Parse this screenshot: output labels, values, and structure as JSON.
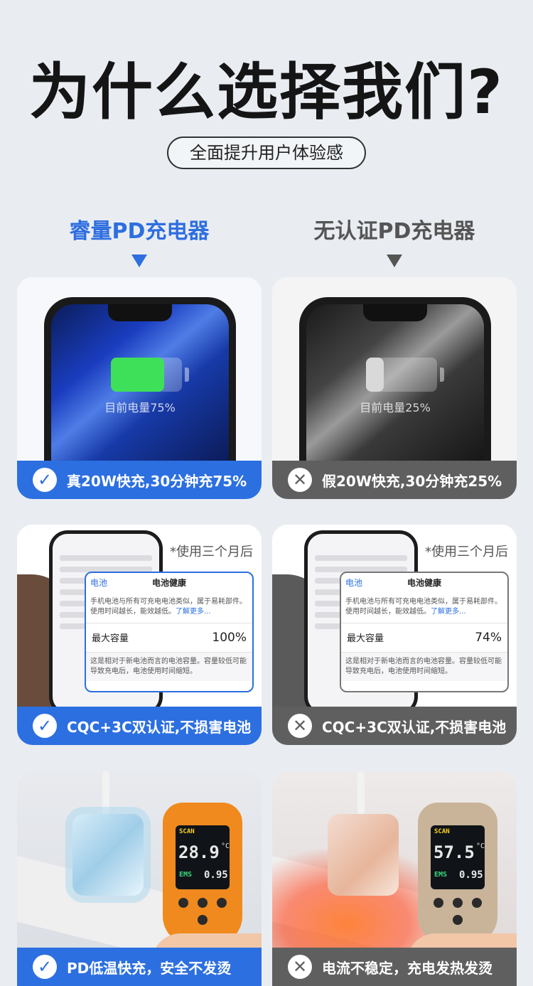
{
  "header": {
    "title": "为什么选择我们?",
    "subtitle": "全面提升用户体验感"
  },
  "columns": {
    "left": {
      "title": "睿量PD充电器",
      "color": "#2f6ee0"
    },
    "right": {
      "title": "无认证PD充电器",
      "color": "#555555"
    }
  },
  "row1": {
    "left": {
      "battery_text": "目前电量75%",
      "battery_level": 0.75,
      "caption": "真20W快充,30分钟充75%",
      "badge": "✓"
    },
    "right": {
      "battery_text": "目前电量25%",
      "battery_level": 0.25,
      "caption": "假20W快充,30分钟充25%",
      "badge": "✕"
    }
  },
  "row2": {
    "left": {
      "after_text": "*使用三个月后",
      "back": "电池",
      "panel_title": "电池健康",
      "desc": "手机电池与所有可充电电池类似，属于易耗部件。使用时间越长，能效越低。",
      "link": "了解更多...",
      "cap_label": "最大容量",
      "cap_value": "100%",
      "note": "这是相对于新电池而言的电池容量。容量较低可能导致充电后，电池使用时间缩短。",
      "caption": "CQC+3C双认证,不损害电池",
      "badge": "✓"
    },
    "right": {
      "after_text": "*使用三个月后",
      "back": "电池",
      "panel_title": "电池健康",
      "desc": "手机电池与所有可充电电池类似，属于易耗部件。使用时间越长，能效越低。",
      "link": "了解更多...",
      "cap_label": "最大容量",
      "cap_value": "74%",
      "note": "这是相对于新电池而言的电池容量。容量较低可能导致充电后，电池使用时间缩短。",
      "caption": "CQC+3C双认证,不损害电池",
      "badge": "✕"
    }
  },
  "row3": {
    "left": {
      "scan": "SCAN",
      "temp": "28.9",
      "unit": "°C",
      "ems": "EMS",
      "emv": "0.95",
      "caption": "PD低温快充，安全不发烫",
      "badge": "✓"
    },
    "right": {
      "scan": "SCAN",
      "temp": "57.5",
      "unit": "°C",
      "ems": "EMS",
      "emv": "0.95",
      "caption": "电流不稳定，充电发热发烫",
      "badge": "✕"
    }
  },
  "colors": {
    "good": "#2c6fe0",
    "bad": "#5f5f5f",
    "battery_green": "#3ee05a",
    "battery_grey": "#d9d9d9"
  }
}
